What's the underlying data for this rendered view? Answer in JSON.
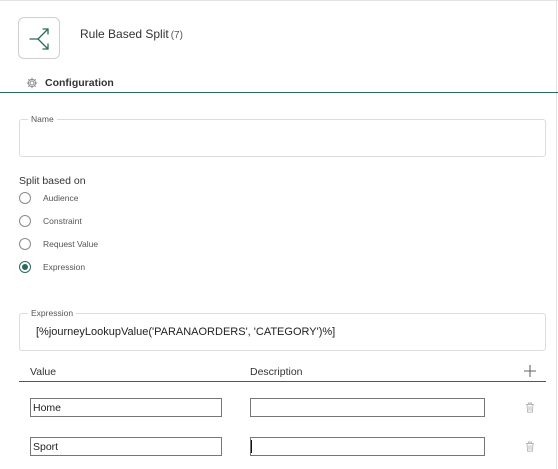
{
  "header": {
    "title": "Rule Based Split",
    "count": "(7)",
    "node_icon": "split-arrows-icon"
  },
  "section": {
    "label": "Configuration",
    "icon": "gear-icon"
  },
  "name_field": {
    "legend": "Name",
    "value": ""
  },
  "split": {
    "label": "Split based on",
    "options": [
      {
        "label": "Audience",
        "checked": false
      },
      {
        "label": "Constraint",
        "checked": false
      },
      {
        "label": "Request Value",
        "checked": false
      },
      {
        "label": "Expression",
        "checked": true
      }
    ]
  },
  "expression": {
    "legend": "Expression",
    "value": "[%journeyLookupValue('PARANAORDERS', 'CATEGORY')%]"
  },
  "table": {
    "columns": [
      "Value",
      "Description"
    ],
    "add_icon": "plus-icon",
    "rows": [
      {
        "value": "Home",
        "description": ""
      },
      {
        "value": "Sport",
        "description": ""
      }
    ],
    "delete_icon": "trash-icon"
  },
  "colors": {
    "accent": "#2b6a5e",
    "border": "#dcdcdc"
  }
}
